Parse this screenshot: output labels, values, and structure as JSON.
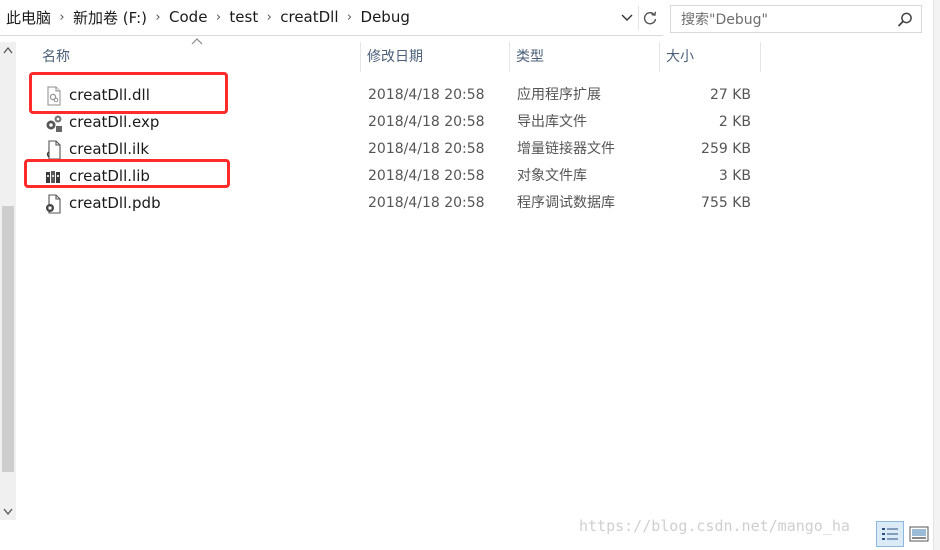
{
  "address_bar": {
    "breadcrumbs": [
      "此电脑",
      "新加卷 (F:)",
      "Code",
      "test",
      "creatDll",
      "Debug"
    ]
  },
  "search": {
    "placeholder": "搜索\"Debug\""
  },
  "columns": {
    "name": "名称",
    "date": "修改日期",
    "type": "类型",
    "size": "大小"
  },
  "files": [
    {
      "name": "creatDll.dll",
      "date": "2018/4/18 20:58",
      "type": "应用程序扩展",
      "size": "27 KB",
      "icon": "dll-file-icon",
      "highlighted": true
    },
    {
      "name": "creatDll.exp",
      "date": "2018/4/18 20:58",
      "type": "导出库文件",
      "size": "2 KB",
      "icon": "exp-file-icon",
      "highlighted": false
    },
    {
      "name": "creatDll.ilk",
      "date": "2018/4/18 20:58",
      "type": "增量链接器文件",
      "size": "259 KB",
      "icon": "ilk-file-icon",
      "highlighted": false
    },
    {
      "name": "creatDll.lib",
      "date": "2018/4/18 20:58",
      "type": "对象文件库",
      "size": "3 KB",
      "icon": "lib-file-icon",
      "highlighted": true
    },
    {
      "name": "creatDll.pdb",
      "date": "2018/4/18 20:58",
      "type": "程序调试数据库",
      "size": "755 KB",
      "icon": "pdb-file-icon",
      "highlighted": false
    }
  ],
  "highlight_color": "#ff2a2a",
  "watermark": "https://blog.csdn.net/mango_ha",
  "colors": {
    "header_text": "#4c607a",
    "accent": "#dbeaf7"
  }
}
